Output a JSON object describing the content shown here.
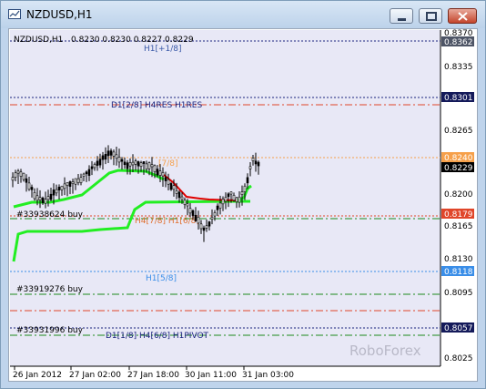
{
  "window": {
    "title": "NZDUSD,H1"
  },
  "chart": {
    "header": {
      "symbol": "NZDUSD,H1",
      "quotes": "0.8230 0.8230 0.8227 0.8229"
    },
    "watermark": "RoboForex",
    "price_axis": {
      "ticks": [
        "0.8370",
        "0.8335",
        "0.8265",
        "0.8200",
        "0.8165",
        "0.8130",
        "0.8095",
        "0.8025"
      ],
      "tags": [
        {
          "label": "0.8362",
          "bg": "#4e5566",
          "fg": "#ffffff"
        },
        {
          "label": "0.8301",
          "bg": "#141a5a",
          "fg": "#ffffff"
        },
        {
          "label": "0.8240",
          "bg": "#f6a04a",
          "fg": "#ffffff"
        },
        {
          "label": "0.8229",
          "bg": "#000000",
          "fg": "#ffffff"
        },
        {
          "label": "0.8179",
          "bg": "#e0462a",
          "fg": "#ffffff"
        },
        {
          "label": "0.8118",
          "bg": "#3a8ee8",
          "fg": "#ffffff"
        },
        {
          "label": "0.8057",
          "bg": "#141a5a",
          "fg": "#ffffff"
        }
      ]
    },
    "time_axis": [
      "26 Jan 2012",
      "27 Jan 02:00",
      "27 Jan 18:00",
      "30 Jan 11:00",
      "31 Jan 03:00"
    ],
    "levels": {
      "h1_plus_1_8": "H1[+1/8]",
      "d1_2_8": "D1[2/8] H4RES H1RES",
      "level_7_8": "[7/8]",
      "level_7_8_h1": "H4[7/8] H1[6/8]",
      "h1_5_8": "H1[5/8]",
      "d1_1_8": "D1[1/8] H4[6/8] H1PIVOT"
    },
    "orders": [
      "#33938624 buy",
      "#33919276 buy",
      "#33931996 buy"
    ],
    "colors": {
      "candles": "#000000",
      "ma_green": "#22ee22",
      "ma_red": "#e00000",
      "level_navy": "#1a237e",
      "level_orange": "#f6a04a",
      "level_red": "#e0462a",
      "level_green": "#1c8a1c",
      "level_blue": "#3a8ee8",
      "chart_bg": "#e8e8f6"
    }
  }
}
